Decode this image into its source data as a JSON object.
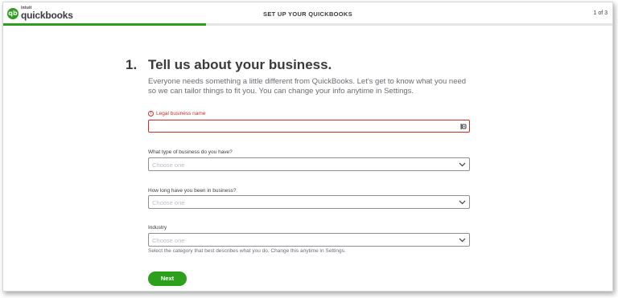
{
  "header": {
    "logo_intuit": "intuit",
    "logo_word": "quickbooks",
    "logo_badge": "qb",
    "title": "SET UP YOUR QUICKBOOKS",
    "step_count": "1 of 3",
    "progress_fraction": 0.333
  },
  "main": {
    "step_number": "1.",
    "heading": "Tell us about your business.",
    "intro": "Everyone needs something a little different from QuickBooks. Let's get to know what you need so we can tailor things to fit you. You can change your info anytime in Settings."
  },
  "form": {
    "business_name": {
      "label": "Legal business name",
      "error_icon": "!",
      "value": ""
    },
    "business_type": {
      "label": "What type of business do you have?",
      "placeholder": "Choose one"
    },
    "business_age": {
      "label": "How long have you been in business?",
      "placeholder": "Choose one"
    },
    "industry": {
      "label": "Industry",
      "placeholder": "Choose one",
      "helper": "Select the category that best describes what you do. Change this anytime in Settings."
    },
    "next_label": "Next"
  },
  "icons": {
    "error": "error-circle-icon",
    "chevron": "chevron-down-icon",
    "autofill": "autofill-icon"
  },
  "colors": {
    "brand_green": "#2ca01c",
    "error_red": "#d52b1e",
    "text_dark": "#393a3d",
    "text_muted": "#6b6c72"
  }
}
